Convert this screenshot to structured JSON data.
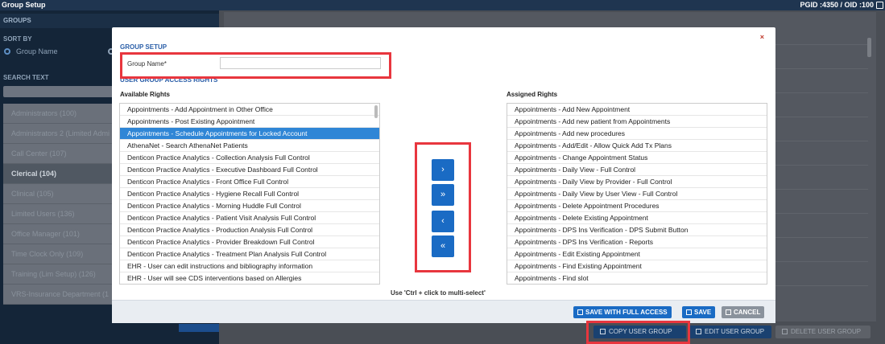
{
  "topbar": {
    "title": "Group Setup",
    "ids": "PGID :4350  /  OID :100"
  },
  "sidebar": {
    "header": "GROUPS",
    "sort_by_label": "SORT BY",
    "sort_option": "Group Name",
    "search_label": "SEARCH TEXT",
    "groups": [
      "Administrators (100)",
      "Administrators 2 (Limited Admi",
      "Call Center (107)",
      "Clerical (104)",
      "Clinical (105)",
      "Limited Users (136)",
      "Office Manager (101)",
      "Time Clock Only (109)",
      "Training (Lim Setup) (126)",
      "VRS-Insurance Department (1"
    ],
    "selected_group_index": 3
  },
  "bottom_buttons": {
    "copy": "COPY USER GROUP",
    "edit": "EDIT USER GROUP",
    "delete": "DELETE USER GROUP"
  },
  "modal": {
    "section_title": "GROUP SETUP",
    "group_name_label": "Group Name*",
    "group_name_value": "",
    "rights_title": "USER GROUP ACCESS RIGHTS",
    "available_title": "Available Rights",
    "assigned_title": "Assigned Rights",
    "available": [
      "Appointments - Add Appointment in Other Office",
      "Appointments - Post Existing Appointment",
      "Appointments - Schedule Appointments for Locked Account",
      "AthenaNet - Search AthenaNet Patients",
      "Denticon Practice Analytics - Collection Analysis Full Control",
      "Denticon Practice Analytics - Executive Dashboard Full Control",
      "Denticon Practice Analytics - Front Office Full Control",
      "Denticon Practice Analytics - Hygiene Recall Full Control",
      "Denticon Practice Analytics - Morning Huddle Full Control",
      "Denticon Practice Analytics - Patient Visit Analysis Full Control",
      "Denticon Practice Analytics - Production Analysis Full Control",
      "Denticon Practice Analytics - Provider Breakdown Full Control",
      "Denticon Practice Analytics - Treatment Plan Analysis Full Control",
      "EHR - User can edit instructions and bibliography information",
      "EHR - User will see CDS interventions based on Allergies"
    ],
    "available_selected_index": 2,
    "assigned": [
      "Appointments - Add New Appointment",
      "Appointments - Add new patient from Appointments",
      "Appointments - Add new procedures",
      "Appointments - Add/Edit - Allow Quick Add Tx Plans",
      "Appointments - Change Appointment Status",
      "Appointments - Daily View - Full Control",
      "Appointments - Daily View by Provider - Full Control",
      "Appointments - Daily View by User View - Full Control",
      "Appointments - Delete Appointment Procedures",
      "Appointments - Delete Existing Appointment",
      "Appointments - DPS Ins Verification - DPS Submit Button",
      "Appointments - DPS Ins Verification - Reports",
      "Appointments - Edit Existing Appointment",
      "Appointments - Find Existing Appointment",
      "Appointments - Find slot"
    ],
    "move_buttons": [
      "›",
      "»",
      "‹",
      "«"
    ],
    "hint": "Use 'Ctrl + click to multi-select'",
    "save_full_label": "SAVE WITH FULL ACCESS",
    "save_label": "SAVE",
    "cancel_label": "CANCEL",
    "close_label": "×"
  },
  "colors": {
    "accent": "#1a6bc4",
    "highlight": "#e8363e",
    "selected_row": "#2f86d6"
  }
}
